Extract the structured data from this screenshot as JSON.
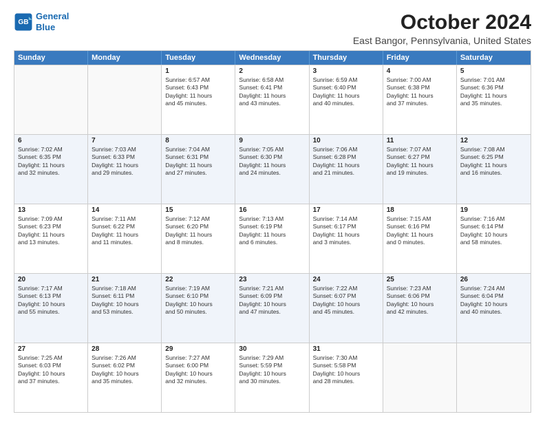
{
  "logo": {
    "line1": "General",
    "line2": "Blue"
  },
  "title": "October 2024",
  "location": "East Bangor, Pennsylvania, United States",
  "days_of_week": [
    "Sunday",
    "Monday",
    "Tuesday",
    "Wednesday",
    "Thursday",
    "Friday",
    "Saturday"
  ],
  "weeks": [
    [
      {
        "day": "",
        "info": ""
      },
      {
        "day": "",
        "info": ""
      },
      {
        "day": "1",
        "info": "Sunrise: 6:57 AM\nSunset: 6:43 PM\nDaylight: 11 hours\nand 45 minutes."
      },
      {
        "day": "2",
        "info": "Sunrise: 6:58 AM\nSunset: 6:41 PM\nDaylight: 11 hours\nand 43 minutes."
      },
      {
        "day": "3",
        "info": "Sunrise: 6:59 AM\nSunset: 6:40 PM\nDaylight: 11 hours\nand 40 minutes."
      },
      {
        "day": "4",
        "info": "Sunrise: 7:00 AM\nSunset: 6:38 PM\nDaylight: 11 hours\nand 37 minutes."
      },
      {
        "day": "5",
        "info": "Sunrise: 7:01 AM\nSunset: 6:36 PM\nDaylight: 11 hours\nand 35 minutes."
      }
    ],
    [
      {
        "day": "6",
        "info": "Sunrise: 7:02 AM\nSunset: 6:35 PM\nDaylight: 11 hours\nand 32 minutes."
      },
      {
        "day": "7",
        "info": "Sunrise: 7:03 AM\nSunset: 6:33 PM\nDaylight: 11 hours\nand 29 minutes."
      },
      {
        "day": "8",
        "info": "Sunrise: 7:04 AM\nSunset: 6:31 PM\nDaylight: 11 hours\nand 27 minutes."
      },
      {
        "day": "9",
        "info": "Sunrise: 7:05 AM\nSunset: 6:30 PM\nDaylight: 11 hours\nand 24 minutes."
      },
      {
        "day": "10",
        "info": "Sunrise: 7:06 AM\nSunset: 6:28 PM\nDaylight: 11 hours\nand 21 minutes."
      },
      {
        "day": "11",
        "info": "Sunrise: 7:07 AM\nSunset: 6:27 PM\nDaylight: 11 hours\nand 19 minutes."
      },
      {
        "day": "12",
        "info": "Sunrise: 7:08 AM\nSunset: 6:25 PM\nDaylight: 11 hours\nand 16 minutes."
      }
    ],
    [
      {
        "day": "13",
        "info": "Sunrise: 7:09 AM\nSunset: 6:23 PM\nDaylight: 11 hours\nand 13 minutes."
      },
      {
        "day": "14",
        "info": "Sunrise: 7:11 AM\nSunset: 6:22 PM\nDaylight: 11 hours\nand 11 minutes."
      },
      {
        "day": "15",
        "info": "Sunrise: 7:12 AM\nSunset: 6:20 PM\nDaylight: 11 hours\nand 8 minutes."
      },
      {
        "day": "16",
        "info": "Sunrise: 7:13 AM\nSunset: 6:19 PM\nDaylight: 11 hours\nand 6 minutes."
      },
      {
        "day": "17",
        "info": "Sunrise: 7:14 AM\nSunset: 6:17 PM\nDaylight: 11 hours\nand 3 minutes."
      },
      {
        "day": "18",
        "info": "Sunrise: 7:15 AM\nSunset: 6:16 PM\nDaylight: 11 hours\nand 0 minutes."
      },
      {
        "day": "19",
        "info": "Sunrise: 7:16 AM\nSunset: 6:14 PM\nDaylight: 10 hours\nand 58 minutes."
      }
    ],
    [
      {
        "day": "20",
        "info": "Sunrise: 7:17 AM\nSunset: 6:13 PM\nDaylight: 10 hours\nand 55 minutes."
      },
      {
        "day": "21",
        "info": "Sunrise: 7:18 AM\nSunset: 6:11 PM\nDaylight: 10 hours\nand 53 minutes."
      },
      {
        "day": "22",
        "info": "Sunrise: 7:19 AM\nSunset: 6:10 PM\nDaylight: 10 hours\nand 50 minutes."
      },
      {
        "day": "23",
        "info": "Sunrise: 7:21 AM\nSunset: 6:09 PM\nDaylight: 10 hours\nand 47 minutes."
      },
      {
        "day": "24",
        "info": "Sunrise: 7:22 AM\nSunset: 6:07 PM\nDaylight: 10 hours\nand 45 minutes."
      },
      {
        "day": "25",
        "info": "Sunrise: 7:23 AM\nSunset: 6:06 PM\nDaylight: 10 hours\nand 42 minutes."
      },
      {
        "day": "26",
        "info": "Sunrise: 7:24 AM\nSunset: 6:04 PM\nDaylight: 10 hours\nand 40 minutes."
      }
    ],
    [
      {
        "day": "27",
        "info": "Sunrise: 7:25 AM\nSunset: 6:03 PM\nDaylight: 10 hours\nand 37 minutes."
      },
      {
        "day": "28",
        "info": "Sunrise: 7:26 AM\nSunset: 6:02 PM\nDaylight: 10 hours\nand 35 minutes."
      },
      {
        "day": "29",
        "info": "Sunrise: 7:27 AM\nSunset: 6:00 PM\nDaylight: 10 hours\nand 32 minutes."
      },
      {
        "day": "30",
        "info": "Sunrise: 7:29 AM\nSunset: 5:59 PM\nDaylight: 10 hours\nand 30 minutes."
      },
      {
        "day": "31",
        "info": "Sunrise: 7:30 AM\nSunset: 5:58 PM\nDaylight: 10 hours\nand 28 minutes."
      },
      {
        "day": "",
        "info": ""
      },
      {
        "day": "",
        "info": ""
      }
    ]
  ]
}
